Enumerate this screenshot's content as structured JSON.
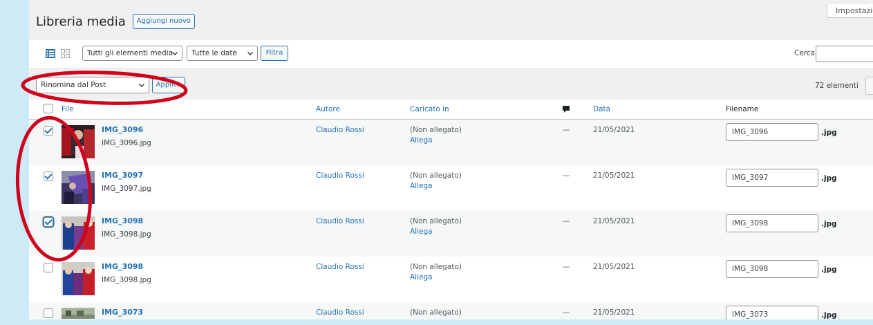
{
  "screen_options_label": "Impostazioni",
  "page_title": "Libreria media",
  "add_new_label": "Aggiungi nuovo",
  "filters": {
    "media_type": "Tutti gli elementi media",
    "dates": "Tutte le date",
    "filter_button": "Filtra",
    "search_label": "Cerca",
    "search_value": ""
  },
  "bulk": {
    "action": "Rinomina dal Post",
    "apply": "Applica",
    "item_count": "72 elementi"
  },
  "columns": {
    "file": "File",
    "author": "Autore",
    "uploaded_to": "Caricato in",
    "comments_icon": "comment-bubble-icon",
    "date": "Data",
    "filename": "Filename"
  },
  "rows": [
    {
      "checked": true,
      "title": "IMG_3096",
      "file": "IMG_3096.jpg",
      "author": "Claudio Rossi",
      "uploaded": "(Non allegato)",
      "attach": "Allega",
      "comments": "—",
      "date": "21/05/2021",
      "filename": "IMG_3096",
      "ext": ".jpg"
    },
    {
      "checked": true,
      "title": "IMG_3097",
      "file": "IMG_3097.jpg",
      "author": "Claudio Rossi",
      "uploaded": "(Non allegato)",
      "attach": "Allega",
      "comments": "—",
      "date": "21/05/2021",
      "filename": "IMG_3097",
      "ext": ".jpg"
    },
    {
      "checked": true,
      "title": "IMG_3098",
      "file": "IMG_3098.jpg",
      "author": "Claudio Rossi",
      "uploaded": "(Non allegato)",
      "attach": "Allega",
      "comments": "—",
      "date": "21/05/2021",
      "filename": "IMG_3098",
      "ext": ".jpg"
    },
    {
      "checked": false,
      "title": "IMG_3098",
      "file": "IMG_3098.jpg",
      "author": "Claudio Rossi",
      "uploaded": "(Non allegato)",
      "attach": "Allega",
      "comments": "—",
      "date": "21/05/2021",
      "filename": "IMG_3098",
      "ext": ".jpg"
    },
    {
      "checked": false,
      "title": "IMG_3073",
      "file": "",
      "author": "Claudio Rossi",
      "uploaded": "(Non allegato)",
      "attach": "",
      "comments": "—",
      "date": "21/05/2021",
      "filename": "IMG_3073",
      "ext": ".jpg"
    }
  ],
  "colors": {
    "accent": "#2271b1",
    "annotation": "#d0021b",
    "backdrop": "#cdeaf7"
  }
}
